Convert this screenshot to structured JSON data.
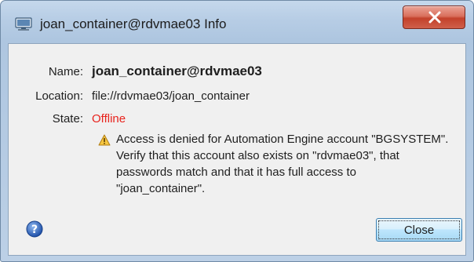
{
  "window": {
    "title": "joan_container@rdvmae03 Info"
  },
  "info": {
    "name_label": "Name:",
    "name_value": "joan_container@rdvmae03",
    "location_label": "Location:",
    "location_value": "file://rdvmae03/joan_container",
    "state_label": "State:",
    "state_value": "Offline",
    "state_color": "#e8221c"
  },
  "warning": {
    "icon": "warning-icon",
    "message": "Access is denied for Automation Engine account \"BGSYSTEM\".\nVerify that this account also exists on \"rdvmae03\", that\npasswords match and that it has full access to\n\"joan_container\"."
  },
  "footer": {
    "help_icon": "help-icon",
    "close_label": "Close"
  }
}
